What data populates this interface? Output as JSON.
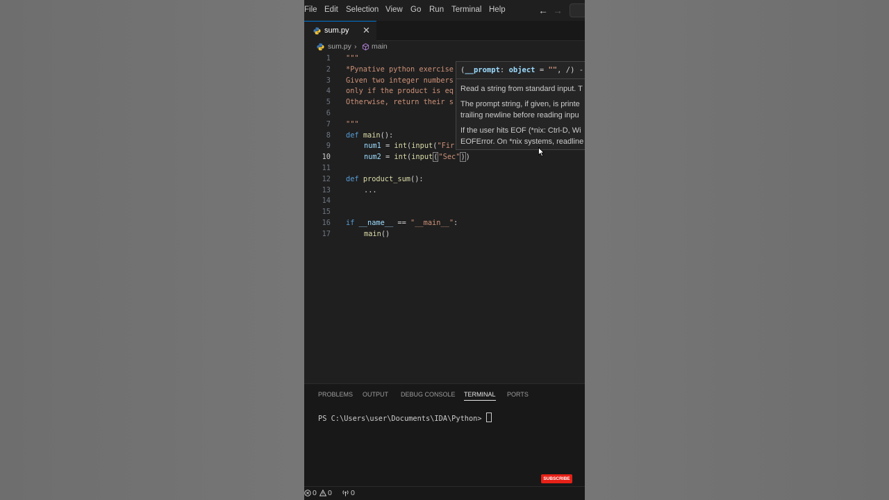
{
  "menubar": {
    "items": [
      "File",
      "Edit",
      "Selection",
      "View",
      "Go",
      "Run",
      "Terminal",
      "Help"
    ],
    "back_icon": "arrow-left-icon",
    "forward_icon": "arrow-right-icon"
  },
  "tab": {
    "label": "sum.py",
    "close": "✕",
    "icon": "python-icon"
  },
  "breadcrumb": {
    "file": "sum.py",
    "separator": "›",
    "symbol": "main",
    "symbol_icon": "cube-icon"
  },
  "editor": {
    "current_line": 10,
    "line_numbers": [
      "1",
      "2",
      "3",
      "4",
      "5",
      "6",
      "7",
      "8",
      "9",
      "10",
      "11",
      "12",
      "13",
      "14",
      "15",
      "16",
      "17"
    ],
    "lines": {
      "l1": "\"\"\"",
      "l2": "*Pynative python exercise",
      "l3": "Given two integer numbers",
      "l4": "only if the product is eq",
      "l5": "Otherwise, return their s",
      "l7": "\"\"\"",
      "l8_kw": "def",
      "l8_fn": "main",
      "l8_rest": "():",
      "l9_var": "num1",
      "l9_op": " = ",
      "l9_fn1": "int",
      "l9_p1": "(",
      "l9_fn2": "input",
      "l9_p2": "(",
      "l9_str": "\"Fir",
      "l10_var": "num2",
      "l10_op": " = ",
      "l10_fn1": "int",
      "l10_p1": "(",
      "l10_fn2": "input",
      "l10_p2": "(",
      "l10_str": "\"Sec\"",
      "l10_close": ")",
      "l10_close2": ")",
      "l12_kw": "def",
      "l12_fn": "product_sum",
      "l12_rest": "():",
      "l13": "...",
      "l16_kw": "if",
      "l16_var": "__name__",
      "l16_op": " == ",
      "l16_str": "\"__main__\"",
      "l16_colon": ":",
      "l17_fn": "main",
      "l17_rest": "()"
    }
  },
  "hover": {
    "sig_open": "(",
    "sig_param": "__prompt",
    "sig_colon": ": ",
    "sig_type": "object",
    "sig_eq": " = ",
    "sig_default": "\"\"",
    "sig_rest": ", /) -",
    "p1": "Read a string from standard input. T",
    "p2a": "The prompt string, if given, is printe",
    "p2b": "trailing newline before reading inpu",
    "p3a": "If the user hits EOF (*nix: Ctrl-D, Wi",
    "p3b": "EOFError. On *nix systems, readline"
  },
  "panel": {
    "tabs": [
      "PROBLEMS",
      "OUTPUT",
      "DEBUG CONSOLE",
      "TERMINAL",
      "PORTS"
    ],
    "active_tab": "TERMINAL",
    "terminal_prompt": "PS C:\\Users\\user\\Documents\\IDA\\Python> "
  },
  "overlay": {
    "subscribe": "SUBSCRIBE"
  },
  "statusbar": {
    "errors": "0",
    "warnings": "0",
    "ports": "0"
  },
  "colors": {
    "accent": "#0078d4",
    "keyword": "#569cd6",
    "function": "#dcdcaa",
    "string": "#ce9178",
    "variable": "#9cdcfe",
    "subscribe": "#e62117"
  }
}
